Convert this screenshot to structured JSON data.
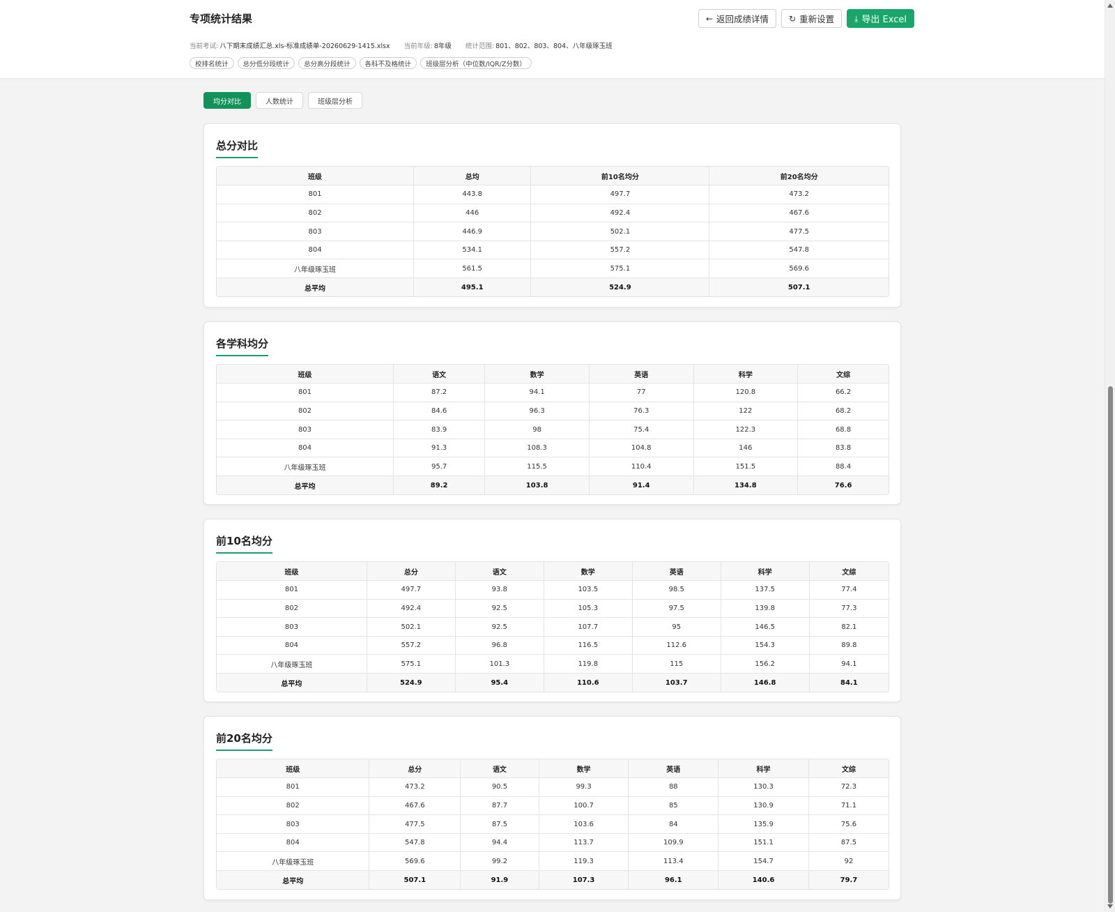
{
  "header": {
    "title": "专项统计结果",
    "back_label": "返回成绩详情",
    "reset_label": "重新设置",
    "export_label": "导出 Excel",
    "exam_label": "当前考试:",
    "exam_value": "八下期末成绩汇总.xls-标准成绩单-20260629-1415.xlsx",
    "grade_label": "当前年级:",
    "grade_value": "8年级",
    "range_label": "统计范围:",
    "range_value": "801、802、803、804、八年级琢玉班",
    "chips": [
      "校排名统计",
      "总分低分段统计",
      "总分高分段统计",
      "各科不及格统计",
      "班级层分析（中位数/IQR/Z分数）"
    ]
  },
  "tabs": [
    "均分对比",
    "人数统计",
    "班级层分析"
  ],
  "cards": [
    {
      "title": "总分对比",
      "columns": [
        "班级",
        "总均",
        "前10名均分",
        "前20名均分"
      ],
      "rows": [
        [
          "801",
          "443.8",
          "497.7",
          "473.2"
        ],
        [
          "802",
          "446",
          "492.4",
          "467.6"
        ],
        [
          "803",
          "446.9",
          "502.1",
          "477.5"
        ],
        [
          "804",
          "534.1",
          "557.2",
          "547.8"
        ],
        [
          "八年级琢玉班",
          "561.5",
          "575.1",
          "569.6"
        ],
        [
          "总平均",
          "495.1",
          "524.9",
          "507.1"
        ]
      ]
    },
    {
      "title": "各学科均分",
      "columns": [
        "班级",
        "语文",
        "数学",
        "英语",
        "科学",
        "文综"
      ],
      "rows": [
        [
          "801",
          "87.2",
          "94.1",
          "77",
          "120.8",
          "66.2"
        ],
        [
          "802",
          "84.6",
          "96.3",
          "76.3",
          "122",
          "68.2"
        ],
        [
          "803",
          "83.9",
          "98",
          "75.4",
          "122.3",
          "68.8"
        ],
        [
          "804",
          "91.3",
          "108.3",
          "104.8",
          "146",
          "83.8"
        ],
        [
          "八年级琢玉班",
          "95.7",
          "115.5",
          "110.4",
          "151.5",
          "88.4"
        ],
        [
          "总平均",
          "89.2",
          "103.8",
          "91.4",
          "134.8",
          "76.6"
        ]
      ]
    },
    {
      "title": "前10名均分",
      "columns": [
        "班级",
        "总分",
        "语文",
        "数学",
        "英语",
        "科学",
        "文综"
      ],
      "rows": [
        [
          "801",
          "497.7",
          "93.8",
          "103.5",
          "98.5",
          "137.5",
          "77.4"
        ],
        [
          "802",
          "492.4",
          "92.5",
          "105.3",
          "97.5",
          "139.8",
          "77.3"
        ],
        [
          "803",
          "502.1",
          "92.5",
          "107.7",
          "95",
          "146.5",
          "82.1"
        ],
        [
          "804",
          "557.2",
          "96.8",
          "116.5",
          "112.6",
          "154.3",
          "89.8"
        ],
        [
          "八年级琢玉班",
          "575.1",
          "101.3",
          "119.8",
          "115",
          "156.2",
          "94.1"
        ],
        [
          "总平均",
          "524.9",
          "95.4",
          "110.6",
          "103.7",
          "146.8",
          "84.1"
        ]
      ]
    },
    {
      "title": "前20名均分",
      "columns": [
        "班级",
        "总分",
        "语文",
        "数学",
        "英语",
        "科学",
        "文综"
      ],
      "rows": [
        [
          "801",
          "473.2",
          "90.5",
          "99.3",
          "88",
          "130.3",
          "72.3"
        ],
        [
          "802",
          "467.6",
          "87.7",
          "100.7",
          "85",
          "130.9",
          "71.1"
        ],
        [
          "803",
          "477.5",
          "87.5",
          "103.6",
          "84",
          "135.9",
          "75.6"
        ],
        [
          "804",
          "547.8",
          "94.4",
          "113.7",
          "109.9",
          "151.1",
          "87.5"
        ],
        [
          "八年级琢玉班",
          "569.6",
          "99.2",
          "119.3",
          "113.4",
          "154.7",
          "92"
        ],
        [
          "总平均",
          "507.1",
          "91.9",
          "107.3",
          "96.1",
          "140.6",
          "79.7"
        ]
      ]
    }
  ],
  "colors": {
    "accent": "#1aa56b",
    "tab_active": "#12915b"
  }
}
